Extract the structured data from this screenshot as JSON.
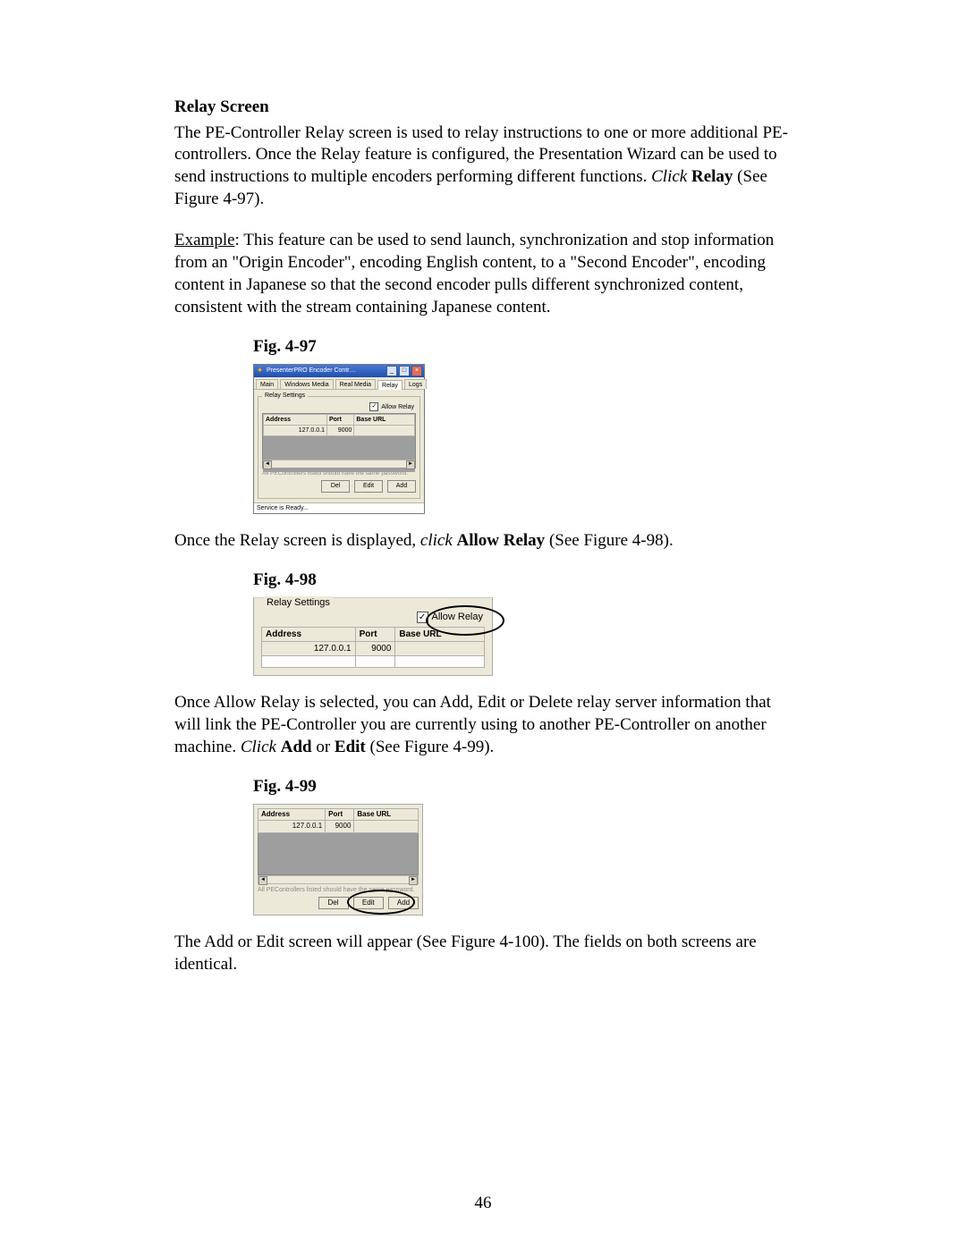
{
  "page_number": "46",
  "heading": "Relay Screen",
  "para1_a": "The PE-Controller Relay screen is used to relay instructions to one or more additional PE-controllers.  Once the Relay feature is configured, the Presentation Wizard can be used to send instructions to multiple encoders performing different functions.  ",
  "para1_click": "Click ",
  "para1_relay": "Relay",
  "para1_tail": " (See Figure 4-97).",
  "example_label": "Example",
  "para2": ":  This feature can be used to send launch, synchronization and stop information from an \"Origin Encoder\", encoding English content, to a \"Second Encoder\", encoding content in Japanese so that the second encoder pulls different synchronized content, consistent with the stream containing Japanese content.",
  "fig97_caption": "Fig. 4-97",
  "fig97": {
    "window_title": "PresenterPRO Encoder Contr…",
    "tabs": {
      "main": "Main",
      "wm": "Windows Media",
      "rm": "Real Media",
      "relay": "Relay",
      "logs": "Logs"
    },
    "fieldset_label": "Relay Settings",
    "allow_relay_label": "Allow Relay",
    "allow_relay_checked": "✓",
    "cols": {
      "address": "Address",
      "port": "Port",
      "baseurl": "Base URL"
    },
    "row": {
      "address": "127.0.0.1",
      "port": "9000"
    },
    "note": "All PEControllers listed should have the same password.",
    "buttons": {
      "del": "Del",
      "edit": "Edit",
      "add": "Add"
    },
    "status": "Service is Ready..."
  },
  "para3_a": "Once the Relay screen is displayed, ",
  "para3_click": "click ",
  "para3_allow": "Allow Relay",
  "para3_tail": " (See Figure 4-98).",
  "fig98_caption": "Fig. 4-98",
  "fig98": {
    "legend": "Relay Settings",
    "allow_label": "Allow Relay",
    "allow_checked": "✓",
    "cols": {
      "address": "Address",
      "port": "Port",
      "baseurl": "Base URL"
    },
    "row": {
      "address": "127.0.0.1",
      "port": "9000"
    }
  },
  "para4_a": "Once Allow Relay is selected, you can Add, Edit or Delete relay server information that will link the PE-Controller you are currently using to another PE-Controller on another machine.  ",
  "para4_click": "Click ",
  "para4_add": "Add",
  "para4_or": " or ",
  "para4_edit": "Edit",
  "para4_tail": " (See Figure 4-99).",
  "fig99_caption": "Fig. 4-99",
  "fig99": {
    "cols": {
      "address": "Address",
      "port": "Port",
      "baseurl": "Base URL"
    },
    "row": {
      "address": "127.0.0.1",
      "port": "9000"
    },
    "note": "All PEControllers listed should have the same password.",
    "buttons": {
      "del": "Del",
      "edit": "Edit",
      "add": "Add"
    }
  },
  "para5": "The Add or Edit screen will appear (See Figure 4-100).  The fields on both screens are identical."
}
